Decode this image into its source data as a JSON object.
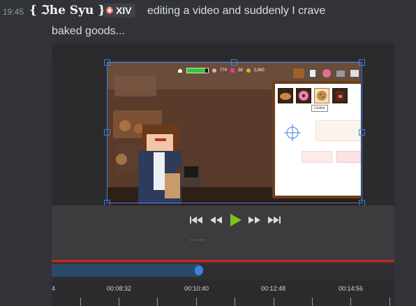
{
  "message": {
    "timestamp": "19:45",
    "username": "{ ℑhe Syu }",
    "clan_tag": "XIV",
    "text_line1": "editing a video and suddenly I crave",
    "text_line2": "baked goods..."
  },
  "game_hud": {
    "hp_fraction": 0.85,
    "stat1": "774",
    "stat2": "38",
    "stat3": "2,000"
  },
  "inventory": {
    "tooltip": "Cookie",
    "slots": [
      "bread",
      "donut",
      "cookie",
      "chocolate"
    ]
  },
  "player": {
    "controls": [
      "skip-back",
      "rewind",
      "play",
      "fast-forward",
      "skip-forward"
    ],
    "dots": "......"
  },
  "timeline": {
    "tick_labels": [
      "00:08:32",
      "00:10:40",
      "00:12:48",
      "00:14:56"
    ],
    "left_tick_partial": "4"
  },
  "colors": {
    "background": "#313338",
    "selection": "#3d7fe0",
    "playhead": "#c42a2a",
    "play_button": "#7dc21f"
  }
}
